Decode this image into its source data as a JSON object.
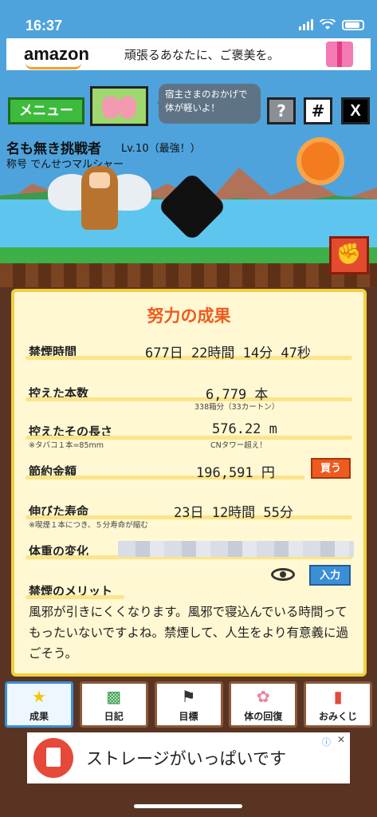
{
  "status_bar": {
    "time": "16:37"
  },
  "top_ad": {
    "logo": "amazon",
    "text": "頑張るあなたに、ご褒美を。"
  },
  "header": {
    "menu_label": "メニュー",
    "speech": "宿主さまのおかげで体が軽いよ！",
    "help_label": "?",
    "grid_label": "#",
    "x_label": "X"
  },
  "player": {
    "name": "名も無き挑戦者",
    "level": "Lv.10（最強！）",
    "title": "称号 でんせつマルシャー"
  },
  "panel": {
    "title": "努力の成果",
    "stats": {
      "quit_time": {
        "label": "禁煙時間",
        "value": "677日 22時間 14分 47秒"
      },
      "avoided_count": {
        "label": "控えた本数",
        "value": "6,779 本",
        "sub": "338箱分（33カートン）"
      },
      "avoided_length": {
        "label": "控えたその長さ",
        "value": "576.22 m",
        "sub": "CNタワー超え！",
        "note": "※タバコ１本=85mm"
      },
      "savings": {
        "label": "節約金額",
        "value": "196,591 円",
        "button": "買う"
      },
      "life_extended": {
        "label": "伸びた寿命",
        "value": "23日 12時間 55分",
        "note": "※喫煙１本につき、５分寿命が縮む"
      },
      "weight_change": {
        "label": "体重の変化",
        "button": "入力"
      }
    },
    "merit": {
      "label": "禁煙のメリット",
      "text": "風邪が引きにくくなります。風邪で寝込んでいる時間ってもったいないですよね。禁煙して、人生をより有意義に過ごそう。"
    }
  },
  "tabs": [
    {
      "label": "成果",
      "icon": "star-icon"
    },
    {
      "label": "日記",
      "icon": "book-icon"
    },
    {
      "label": "目標",
      "icon": "flag-icon"
    },
    {
      "label": "体の回復",
      "icon": "lungs-icon"
    },
    {
      "label": "おみくじ",
      "icon": "omikuji-icon"
    }
  ],
  "bottom_ad": {
    "text": "ストレージがいっぱいです"
  },
  "colors": {
    "accent": "#ef5a1f",
    "panel_bg": "#fff8d2",
    "panel_border": "#f2cf3e",
    "sky": "#4ea3dc"
  }
}
